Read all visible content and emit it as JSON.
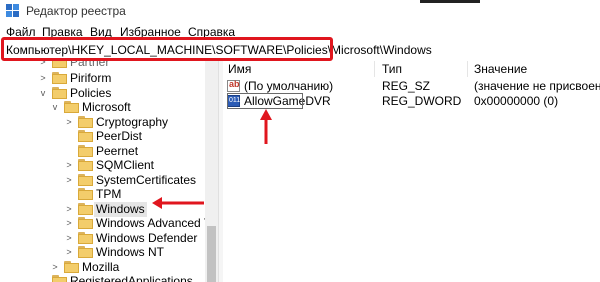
{
  "window": {
    "title": "Редактор реестра",
    "accent": "#e0161e"
  },
  "menu": [
    "Файл",
    "Правка",
    "Вид",
    "Избранное",
    "Справка"
  ],
  "address": {
    "path": "Компьютер\\HKEY_LOCAL_MACHINE\\SOFTWARE\\Policies\\Microsoft\\Windows"
  },
  "tree": {
    "partial_top": "Partner",
    "nodes": [
      {
        "label": "Piriform",
        "expander": ">"
      },
      {
        "label": "Policies",
        "expander": "v"
      },
      {
        "label": "Microsoft",
        "expander": "v"
      },
      {
        "label": "Cryptography",
        "expander": ">"
      },
      {
        "label": "PeerDist",
        "expander": ""
      },
      {
        "label": "Peernet",
        "expander": ""
      },
      {
        "label": "SQMClient",
        "expander": ">"
      },
      {
        "label": "SystemCertificates",
        "expander": ">"
      },
      {
        "label": "TPM",
        "expander": ""
      },
      {
        "label": "Windows",
        "expander": ">"
      },
      {
        "label": "Windows Advanced Threat",
        "expander": ">"
      },
      {
        "label": "Windows Defender",
        "expander": ">"
      },
      {
        "label": "Windows NT",
        "expander": ">"
      },
      {
        "label": "Mozilla",
        "expander": ">"
      },
      {
        "label": "RegisteredApplications",
        "expander": ""
      }
    ],
    "selected": "Windows"
  },
  "list": {
    "columns": [
      "Имя",
      "Тип",
      "Значение"
    ],
    "rows": [
      {
        "icon": "string-value-icon",
        "icon_text": "ab",
        "name": "(По умолчанию)",
        "type": "REG_SZ",
        "value": "(значение не присвоено)"
      },
      {
        "icon": "dword-value-icon",
        "icon_text": "011",
        "name": "AllowGameDVR",
        "type": "REG_DWORD",
        "value": "0x00000000 (0)"
      }
    ]
  }
}
